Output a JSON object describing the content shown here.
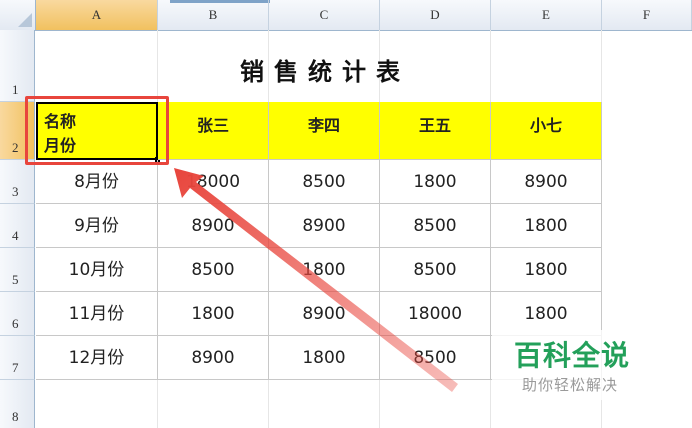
{
  "columns": [
    "A",
    "B",
    "C",
    "D",
    "E",
    "F"
  ],
  "rows": [
    "1",
    "2",
    "3",
    "4",
    "5",
    "6",
    "7",
    "8"
  ],
  "title": "销售统计表",
  "a2": {
    "line1": "名称",
    "line2": "月份"
  },
  "header_names": [
    "张三",
    "李四",
    "王五",
    "小七"
  ],
  "table": [
    {
      "month": "8月份",
      "values": [
        "18000",
        "8500",
        "1800",
        "8900"
      ]
    },
    {
      "month": "9月份",
      "values": [
        "8900",
        "8900",
        "8500",
        "1800"
      ]
    },
    {
      "month": "10月份",
      "values": [
        "8500",
        "1800",
        "8500",
        "1800"
      ]
    },
    {
      "month": "11月份",
      "values": [
        "1800",
        "8900",
        "18000",
        "1800"
      ]
    },
    {
      "month": "12月份",
      "values": [
        "8900",
        "1800",
        "8500",
        ""
      ]
    }
  ],
  "watermark": {
    "main": "百科全说",
    "sub": "助你轻松解决"
  },
  "colors": {
    "header_fill": "#ffff00",
    "annotation": "#e8453c",
    "watermark": "#23a05a"
  }
}
